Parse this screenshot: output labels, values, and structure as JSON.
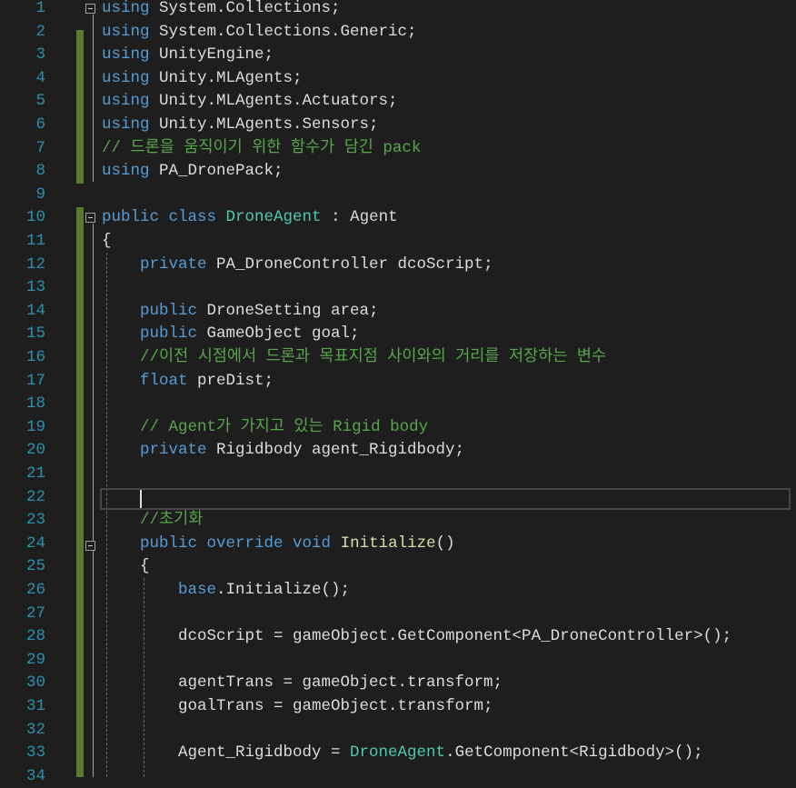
{
  "editor": {
    "colors": {
      "background": "#1e1e1e",
      "keyword": "#569cd6",
      "type": "#4ec9b0",
      "comment": "#57a64a",
      "text": "#dcdcdc",
      "line_number": "#2b91af",
      "change_bar": "#5b7a2f"
    },
    "current_line": 22,
    "lines": [
      {
        "n": "1",
        "indent": 0,
        "tokens": [
          [
            "kw",
            "using"
          ],
          [
            "tx",
            " System.Collections;"
          ]
        ]
      },
      {
        "n": "2",
        "indent": 0,
        "tokens": [
          [
            "kw",
            "using"
          ],
          [
            "tx",
            " System.Collections.Generic;"
          ]
        ]
      },
      {
        "n": "3",
        "indent": 0,
        "tokens": [
          [
            "kw",
            "using"
          ],
          [
            "tx",
            " UnityEngine;"
          ]
        ]
      },
      {
        "n": "4",
        "indent": 0,
        "tokens": [
          [
            "kw",
            "using"
          ],
          [
            "tx",
            " Unity.MLAgents;"
          ]
        ]
      },
      {
        "n": "5",
        "indent": 0,
        "tokens": [
          [
            "kw",
            "using"
          ],
          [
            "tx",
            " Unity.MLAgents.Actuators;"
          ]
        ]
      },
      {
        "n": "6",
        "indent": 0,
        "tokens": [
          [
            "kw",
            "using"
          ],
          [
            "tx",
            " Unity.MLAgents.Sensors;"
          ]
        ]
      },
      {
        "n": "7",
        "indent": 0,
        "tokens": [
          [
            "cm",
            "// 드론을 움직이기 위한 함수가 담긴 pack"
          ]
        ]
      },
      {
        "n": "8",
        "indent": 0,
        "tokens": [
          [
            "kw",
            "using"
          ],
          [
            "tx",
            " PA_DronePack;"
          ]
        ]
      },
      {
        "n": "9",
        "indent": 0,
        "tokens": []
      },
      {
        "n": "10",
        "indent": 0,
        "tokens": [
          [
            "kw",
            "public class"
          ],
          [
            "tx",
            " "
          ],
          [
            "ty",
            "DroneAgent"
          ],
          [
            "tx",
            " : Agent"
          ]
        ]
      },
      {
        "n": "11",
        "indent": 0,
        "tokens": [
          [
            "tx",
            "{"
          ]
        ]
      },
      {
        "n": "12",
        "indent": 1,
        "tokens": [
          [
            "kw",
            "private"
          ],
          [
            "tx",
            " PA_DroneController dcoScript;"
          ]
        ]
      },
      {
        "n": "13",
        "indent": 1,
        "tokens": []
      },
      {
        "n": "14",
        "indent": 1,
        "tokens": [
          [
            "kw",
            "public"
          ],
          [
            "tx",
            " DroneSetting area;"
          ]
        ]
      },
      {
        "n": "15",
        "indent": 1,
        "tokens": [
          [
            "kw",
            "public"
          ],
          [
            "tx",
            " GameObject goal;"
          ]
        ]
      },
      {
        "n": "16",
        "indent": 1,
        "tokens": [
          [
            "cm",
            "//이전 시점에서 드론과 목표지점 사이와의 거리를 저장하는 변수"
          ]
        ]
      },
      {
        "n": "17",
        "indent": 1,
        "tokens": [
          [
            "kw",
            "float"
          ],
          [
            "tx",
            " preDist;"
          ]
        ]
      },
      {
        "n": "18",
        "indent": 1,
        "tokens": []
      },
      {
        "n": "19",
        "indent": 1,
        "tokens": [
          [
            "cm",
            "// Agent가 가지고 있는 Rigid body"
          ]
        ]
      },
      {
        "n": "20",
        "indent": 1,
        "tokens": [
          [
            "kw",
            "private"
          ],
          [
            "tx",
            " Rigidbody agent_Rigidbody;"
          ]
        ]
      },
      {
        "n": "21",
        "indent": 1,
        "tokens": []
      },
      {
        "n": "22",
        "indent": 1,
        "tokens": []
      },
      {
        "n": "23",
        "indent": 1,
        "tokens": [
          [
            "cm",
            "//초기화"
          ]
        ]
      },
      {
        "n": "24",
        "indent": 1,
        "tokens": [
          [
            "kw",
            "public override void"
          ],
          [
            "tx",
            " "
          ],
          [
            "fn",
            "Initialize"
          ],
          [
            "tx",
            "()"
          ]
        ]
      },
      {
        "n": "25",
        "indent": 1,
        "tokens": [
          [
            "tx",
            "{"
          ]
        ]
      },
      {
        "n": "26",
        "indent": 2,
        "tokens": [
          [
            "kw",
            "base"
          ],
          [
            "tx",
            ".Initialize();"
          ]
        ]
      },
      {
        "n": "27",
        "indent": 2,
        "tokens": []
      },
      {
        "n": "28",
        "indent": 2,
        "tokens": [
          [
            "tx",
            "dcoScript = gameObject.GetComponent<PA_DroneController>();"
          ]
        ]
      },
      {
        "n": "29",
        "indent": 2,
        "tokens": []
      },
      {
        "n": "30",
        "indent": 2,
        "tokens": [
          [
            "tx",
            "agentTrans = gameObject.transform;"
          ]
        ]
      },
      {
        "n": "31",
        "indent": 2,
        "tokens": [
          [
            "tx",
            "goalTrans = gameObject.transform;"
          ]
        ]
      },
      {
        "n": "32",
        "indent": 2,
        "tokens": []
      },
      {
        "n": "33",
        "indent": 2,
        "tokens": [
          [
            "tx",
            "Agent_Rigidbody = "
          ],
          [
            "ty",
            "DroneAgent"
          ],
          [
            "tx",
            ".GetComponent<Rigidbody>();"
          ]
        ]
      },
      {
        "n": "34",
        "indent": 2,
        "tokens": []
      }
    ]
  }
}
